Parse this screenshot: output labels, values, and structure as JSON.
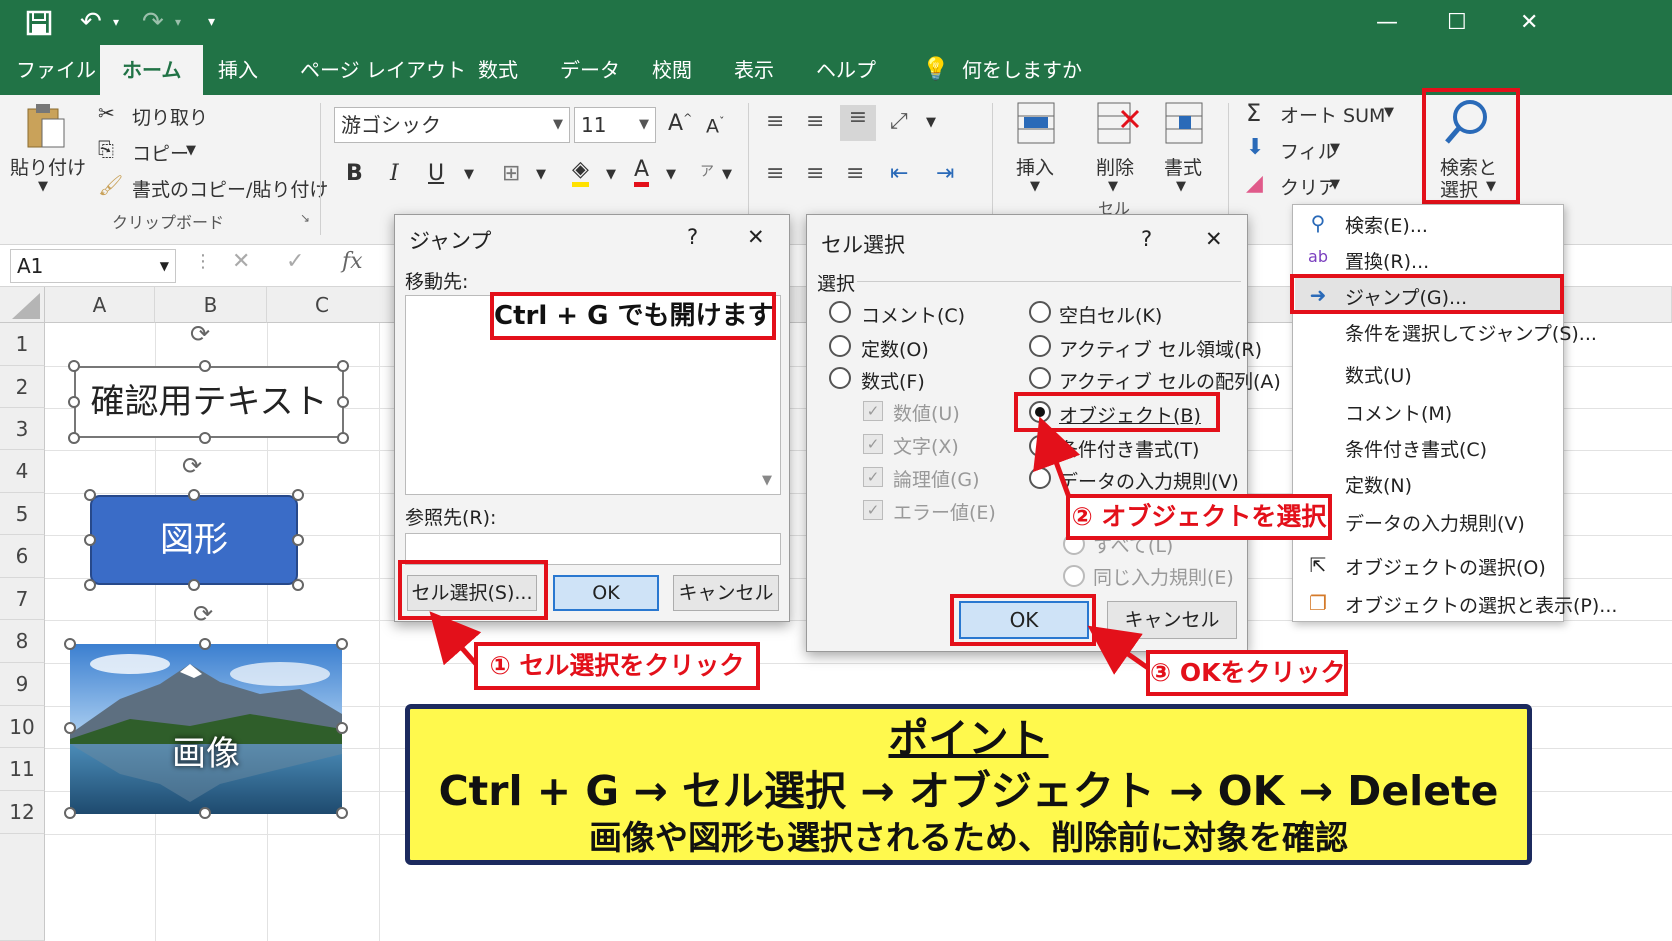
{
  "titlebar": {
    "window_controls": [
      "—",
      "☐",
      "✕"
    ]
  },
  "tabs": [
    "ファイル",
    "ホーム",
    "挿入",
    "ページ レイアウト",
    "数式",
    "データ",
    "校閲",
    "表示",
    "ヘルプ"
  ],
  "tell_me": "何をしますか",
  "ribbon": {
    "paste": "貼り付け",
    "cut": "切り取り",
    "copy": "コピー",
    "format_painter": "書式のコピー/貼り付け",
    "clipboard_group": "クリップボード",
    "font_name": "游ゴシック",
    "font_size": "11",
    "bold": "B",
    "italic": "I",
    "underline": "U",
    "insert": "挿入",
    "delete": "削除",
    "format": "書式",
    "cells_group": "セル",
    "autosum": "オート SUM",
    "fill": "フィル",
    "clear": "クリア",
    "find_select": "検索と",
    "find_select2": "選択"
  },
  "formula": {
    "namebox": "A1",
    "fx": "fx"
  },
  "grid": {
    "columns": [
      "A",
      "B",
      "C"
    ],
    "rows": [
      "1",
      "2",
      "3",
      "4",
      "5",
      "6",
      "7",
      "8",
      "9",
      "10",
      "11",
      "12"
    ],
    "textbox": "確認用テキスト",
    "shape": "図形",
    "image_label": "画像"
  },
  "jump_dialog": {
    "title": "ジャンプ",
    "help": "?",
    "close": "✕",
    "goto_label": "移動先:",
    "ref_label": "参照先(R):",
    "special_button": "セル選択(S)...",
    "ok": "OK",
    "cancel": "キャンセル"
  },
  "select_dialog": {
    "title": "セル選択",
    "help": "?",
    "close": "✕",
    "group": "選択",
    "left_options": [
      "コメント(C)",
      "定数(O)",
      "数式(F)"
    ],
    "sub_options": [
      "数値(U)",
      "文字(X)",
      "論理値(G)",
      "エラー値(E)"
    ],
    "right_options": [
      "空白セル(K)",
      "アクティブ セル領域(R)",
      "アクティブ セルの配列(A)",
      "オブジェクト(B)",
      "条件付き書式(T)",
      "データの入力規則(V)"
    ],
    "validation_sub": [
      "すべて(L)",
      "同じ入力規則(E)"
    ],
    "ok": "OK",
    "cancel": "キャンセル"
  },
  "menu": {
    "items": [
      "検索(E)...",
      "置換(R)...",
      "ジャンプ(G)...",
      "条件を選択してジャンプ(S)...",
      "数式(U)",
      "コメント(M)",
      "条件付き書式(C)",
      "定数(N)",
      "データの入力規則(V)",
      "オブジェクトの選択(O)",
      "オブジェクトの選択と表示(P)..."
    ]
  },
  "callouts": {
    "ctrl_g": "Ctrl + G でも開けます",
    "step1": "① セル選択をクリック",
    "step2": "② オブジェクトを選択",
    "step3": "③ OKをクリック"
  },
  "point": {
    "title": "ポイント",
    "line1": "Ctrl + G → セル選択 → オブジェクト → OK → Delete",
    "line2": "画像や図形も選択されるため、削除前に対象を確認"
  },
  "colors": {
    "excel_green": "#217346",
    "annotation_red": "#e3101a",
    "point_yellow": "#fff94d",
    "point_border": "#1c2a5e",
    "shape_blue": "#3a6cc7"
  }
}
